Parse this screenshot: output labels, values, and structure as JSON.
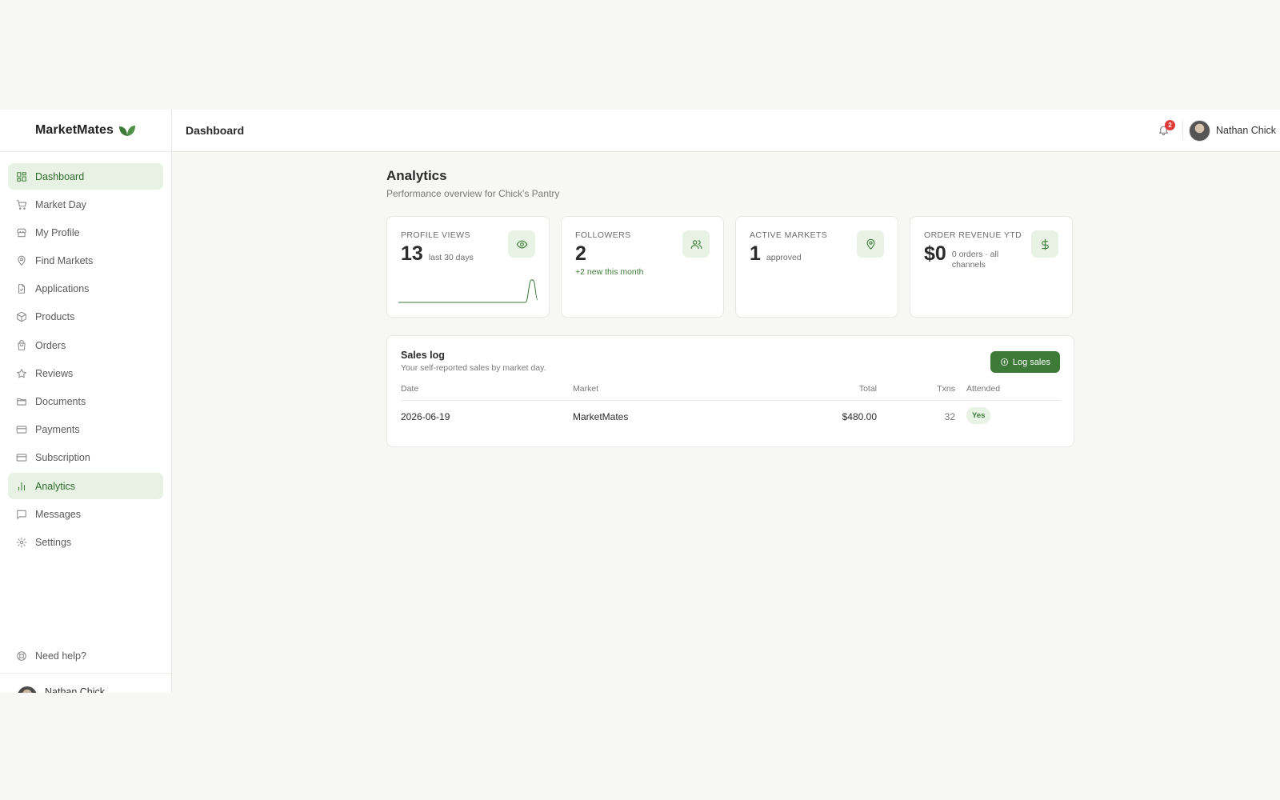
{
  "brand": {
    "name": "MarketMates"
  },
  "topbar": {
    "title": "Dashboard",
    "notification_count": "2",
    "user_name": "Nathan Chick"
  },
  "sidebar": {
    "items": [
      {
        "label": "Dashboard",
        "icon": "dashboard-icon",
        "active": true
      },
      {
        "label": "Market Day",
        "icon": "cart-icon"
      },
      {
        "label": "My Profile",
        "icon": "store-icon"
      },
      {
        "label": "Find Markets",
        "icon": "map-pin-icon"
      },
      {
        "label": "Applications",
        "icon": "file-icon"
      },
      {
        "label": "Products",
        "icon": "package-icon"
      },
      {
        "label": "Orders",
        "icon": "shopping-bag-icon"
      },
      {
        "label": "Reviews",
        "icon": "star-icon"
      },
      {
        "label": "Documents",
        "icon": "folder-icon"
      },
      {
        "label": "Payments",
        "icon": "credit-card-icon"
      },
      {
        "label": "Subscription",
        "icon": "credit-card-icon"
      },
      {
        "label": "Analytics",
        "icon": "bar-chart-icon",
        "active": true
      },
      {
        "label": "Messages",
        "icon": "message-icon"
      },
      {
        "label": "Settings",
        "icon": "gear-icon"
      }
    ],
    "help_label": "Need help?",
    "user_name": "Nathan Chick"
  },
  "page": {
    "title": "Analytics",
    "subtitle": "Performance overview for Chick's Pantry"
  },
  "stats": [
    {
      "label": "PROFILE VIEWS",
      "value": "13",
      "meta": "last 30 days",
      "icon": "eye-icon"
    },
    {
      "label": "FOLLOWERS",
      "value": "2",
      "note": "+2 new this month",
      "icon": "users-icon"
    },
    {
      "label": "ACTIVE MARKETS",
      "value": "1",
      "meta": "approved",
      "icon": "map-pin-icon"
    },
    {
      "label": "ORDER REVENUE YTD",
      "value": "$0",
      "meta": "0 orders · all channels",
      "icon": "dollar-icon"
    }
  ],
  "sales_log": {
    "title": "Sales log",
    "subtitle": "Your self-reported sales by market day.",
    "button_label": "Log sales",
    "columns": [
      "Date",
      "Market",
      "Total",
      "Txns",
      "Attended"
    ],
    "rows": [
      {
        "date": "2026-06-19",
        "market": "MarketMates",
        "total": "$480.00",
        "txns": "32",
        "attended": "Yes"
      }
    ]
  },
  "colors": {
    "accent": "#3d7a38",
    "accent_soft": "#e8f2e5",
    "badge": "#e23b3b"
  }
}
